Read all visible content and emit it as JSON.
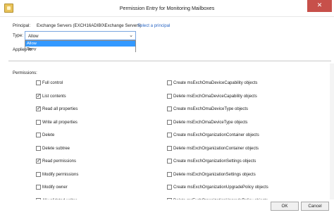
{
  "window": {
    "title": "Permission Entry for Monitoring Mailboxes",
    "close_glyph": "✕"
  },
  "principal": {
    "label": "Principal:",
    "value": "Exchange Servers (EXCH16ADIB0\\Exchange Servers)",
    "link": "Select a principal"
  },
  "type": {
    "label": "Type:",
    "selected": "Allow",
    "arrow": "⌄",
    "options": [
      "Allow",
      "Deny"
    ],
    "highlighted": "Allow"
  },
  "applies_to": {
    "label": "Applies to:"
  },
  "permissions": {
    "label": "Permissions:",
    "left": [
      {
        "label": "Full control",
        "checked": false
      },
      {
        "label": "List contents",
        "checked": true
      },
      {
        "label": "Read all properties",
        "checked": true
      },
      {
        "label": "Write all properties",
        "checked": false
      },
      {
        "label": "Delete",
        "checked": false
      },
      {
        "label": "Delete subtree",
        "checked": false
      },
      {
        "label": "Read permissions",
        "checked": true
      },
      {
        "label": "Modify permissions",
        "checked": false
      },
      {
        "label": "Modify owner",
        "checked": false
      },
      {
        "label": "All validated writes",
        "checked": false
      }
    ],
    "right": [
      {
        "label": "Create msExchOmaDeviceCapability objects",
        "checked": false
      },
      {
        "label": "Delete msExchOmaDeviceCapability objects",
        "checked": false
      },
      {
        "label": "Create msExchOmaDeviceType objects",
        "checked": false
      },
      {
        "label": "Delete msExchOmaDeviceType objects",
        "checked": false
      },
      {
        "label": "Create msExchOrganizationContainer objects",
        "checked": false
      },
      {
        "label": "Delete msExchOrganizationContainer objects",
        "checked": false
      },
      {
        "label": "Create msExchOrganizationSettings objects",
        "checked": false
      },
      {
        "label": "Delete msExchOrganizationSettings objects",
        "checked": false
      },
      {
        "label": "Create msExchOrganizationUpgradePolicy objects",
        "checked": false
      },
      {
        "label": "Delete msExchOrganizationUpgradePolicy objects",
        "checked": false
      }
    ]
  },
  "buttons": {
    "ok": "OK",
    "cancel": "Cancel"
  },
  "check_glyph": "✓"
}
